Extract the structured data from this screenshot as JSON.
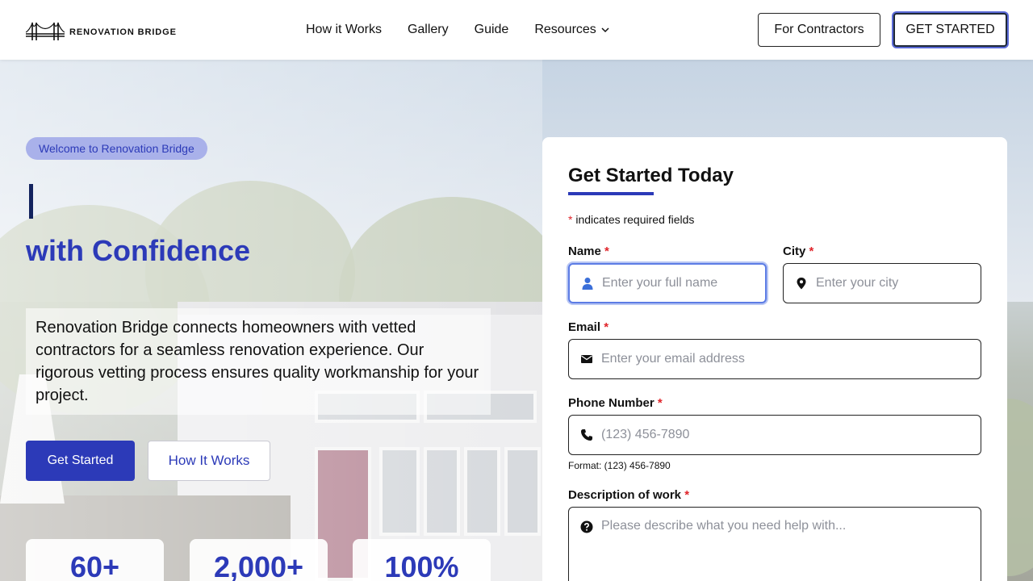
{
  "brand": {
    "name": "RENOVATION BRIDGE"
  },
  "nav": {
    "items": [
      {
        "label": "How it Works"
      },
      {
        "label": "Gallery"
      },
      {
        "label": "Guide"
      },
      {
        "label": "Resources"
      }
    ],
    "contractors_button": "For Contractors",
    "get_started_button": "GET STARTED"
  },
  "hero": {
    "badge": "Welcome to Renovation Bridge",
    "title_line": "with Confidence",
    "description": "Renovation Bridge connects homeowners with vetted contractors for a seamless renovation experience. Our rigorous vetting process ensures quality workmanship for your project.",
    "primary_button": "Get Started",
    "secondary_button": "How It Works",
    "stats": [
      {
        "value": "60+"
      },
      {
        "value": "2,000+"
      },
      {
        "value": "100%"
      }
    ]
  },
  "form": {
    "title": "Get Started Today",
    "required_star": "*",
    "required_note": "indicates required fields",
    "name": {
      "label": "Name",
      "placeholder": "Enter your full name"
    },
    "city": {
      "label": "City",
      "placeholder": "Enter your city"
    },
    "email": {
      "label": "Email",
      "placeholder": "Enter your email address"
    },
    "phone": {
      "label": "Phone Number",
      "placeholder": "(123) 456-7890",
      "hint": "Format: (123) 456-7890"
    },
    "description": {
      "label": "Description of work",
      "placeholder": "Please describe what you need help with..."
    }
  },
  "colors": {
    "accent": "#2c3ab8",
    "required": "#e0242a",
    "focus": "#5c7ce5"
  },
  "icons": {
    "name": "person-icon",
    "city": "location-pin-icon",
    "email": "envelope-icon",
    "phone": "phone-icon",
    "description": "question-circle-icon"
  }
}
